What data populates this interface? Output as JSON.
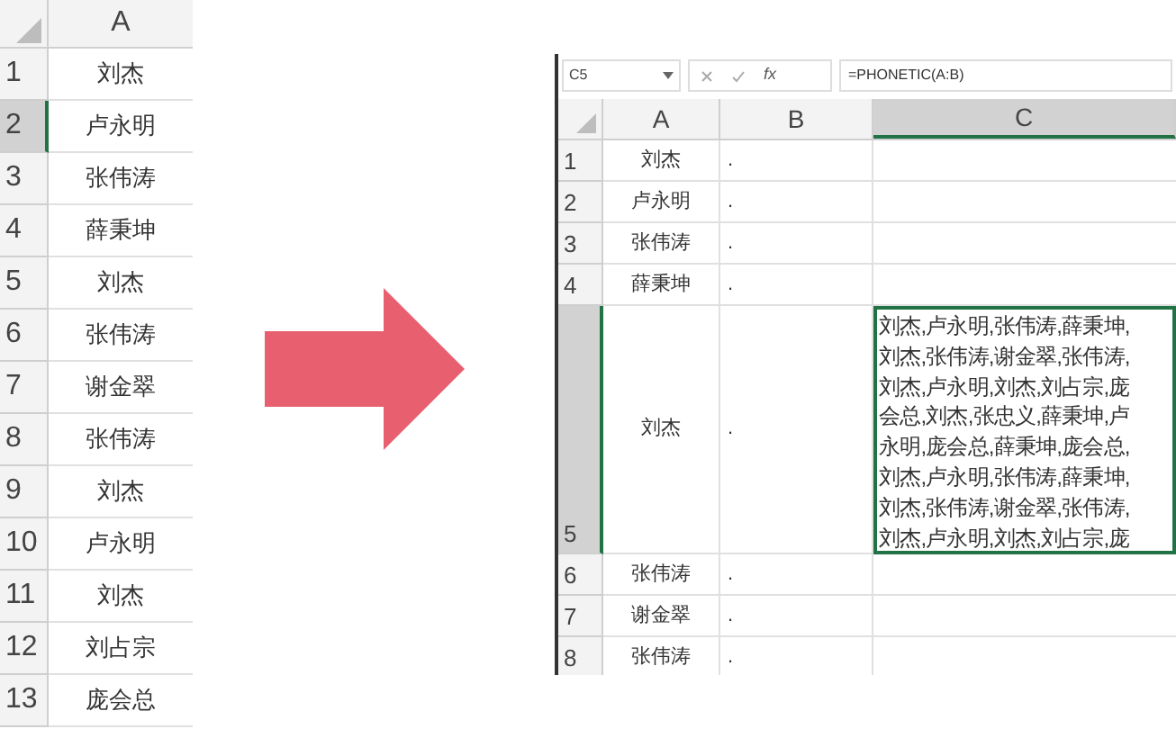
{
  "left_sheet": {
    "columns": [
      {
        "label": "A"
      }
    ],
    "rows": [
      {
        "number": "1",
        "selected": false,
        "cells": [
          "刘杰"
        ]
      },
      {
        "number": "2",
        "selected": true,
        "cells": [
          "卢永明"
        ]
      },
      {
        "number": "3",
        "selected": false,
        "cells": [
          "张伟涛"
        ]
      },
      {
        "number": "4",
        "selected": false,
        "cells": [
          "薛秉坤"
        ]
      },
      {
        "number": "5",
        "selected": false,
        "cells": [
          "刘杰"
        ]
      },
      {
        "number": "6",
        "selected": false,
        "cells": [
          "张伟涛"
        ]
      },
      {
        "number": "7",
        "selected": false,
        "cells": [
          "谢金翠"
        ]
      },
      {
        "number": "8",
        "selected": false,
        "cells": [
          "张伟涛"
        ]
      },
      {
        "number": "9",
        "selected": false,
        "cells": [
          "刘杰"
        ]
      },
      {
        "number": "10",
        "selected": false,
        "cells": [
          "卢永明"
        ]
      },
      {
        "number": "11",
        "selected": false,
        "cells": [
          "刘杰"
        ]
      },
      {
        "number": "12",
        "selected": false,
        "cells": [
          "刘占宗"
        ]
      },
      {
        "number": "13",
        "selected": false,
        "cells": [
          "庞会总"
        ]
      }
    ]
  },
  "right_sheet": {
    "name_box": "C5",
    "function_label": "fx",
    "formula": "=PHONETIC(A:B)",
    "columns": [
      {
        "label": "A",
        "selected": false
      },
      {
        "label": "B",
        "selected": false
      },
      {
        "label": "C",
        "selected": true
      }
    ],
    "rows": [
      {
        "number": "1",
        "selected": false,
        "cells": [
          "刘杰",
          "."
        ]
      },
      {
        "number": "2",
        "selected": false,
        "cells": [
          "卢永明",
          "."
        ]
      },
      {
        "number": "3",
        "selected": false,
        "cells": [
          "张伟涛",
          "."
        ]
      },
      {
        "number": "4",
        "selected": false,
        "cells": [
          "薛秉坤",
          "."
        ]
      },
      {
        "number": "5",
        "selected": true,
        "cells": [
          "刘杰",
          "."
        ],
        "c_lines": [
          "刘杰,卢永明,张伟涛,薛秉坤,",
          "刘杰,张伟涛,谢金翠,张伟涛,",
          "刘杰,卢永明,刘杰,刘占宗,庞",
          "会总,刘杰,张忠义,薛秉坤,卢",
          "永明,庞会总,薛秉坤,庞会总,",
          "刘杰,卢永明,张伟涛,薛秉坤,",
          "刘杰,张伟涛,谢金翠,张伟涛,",
          "刘杰,卢永明,刘杰,刘占宗,庞"
        ]
      },
      {
        "number": "6",
        "selected": false,
        "cells": [
          "张伟涛",
          "."
        ]
      },
      {
        "number": "7",
        "selected": false,
        "cells": [
          "谢金翠",
          "."
        ]
      },
      {
        "number": "8",
        "selected": false,
        "cells": [
          "张伟涛",
          "."
        ]
      }
    ]
  }
}
